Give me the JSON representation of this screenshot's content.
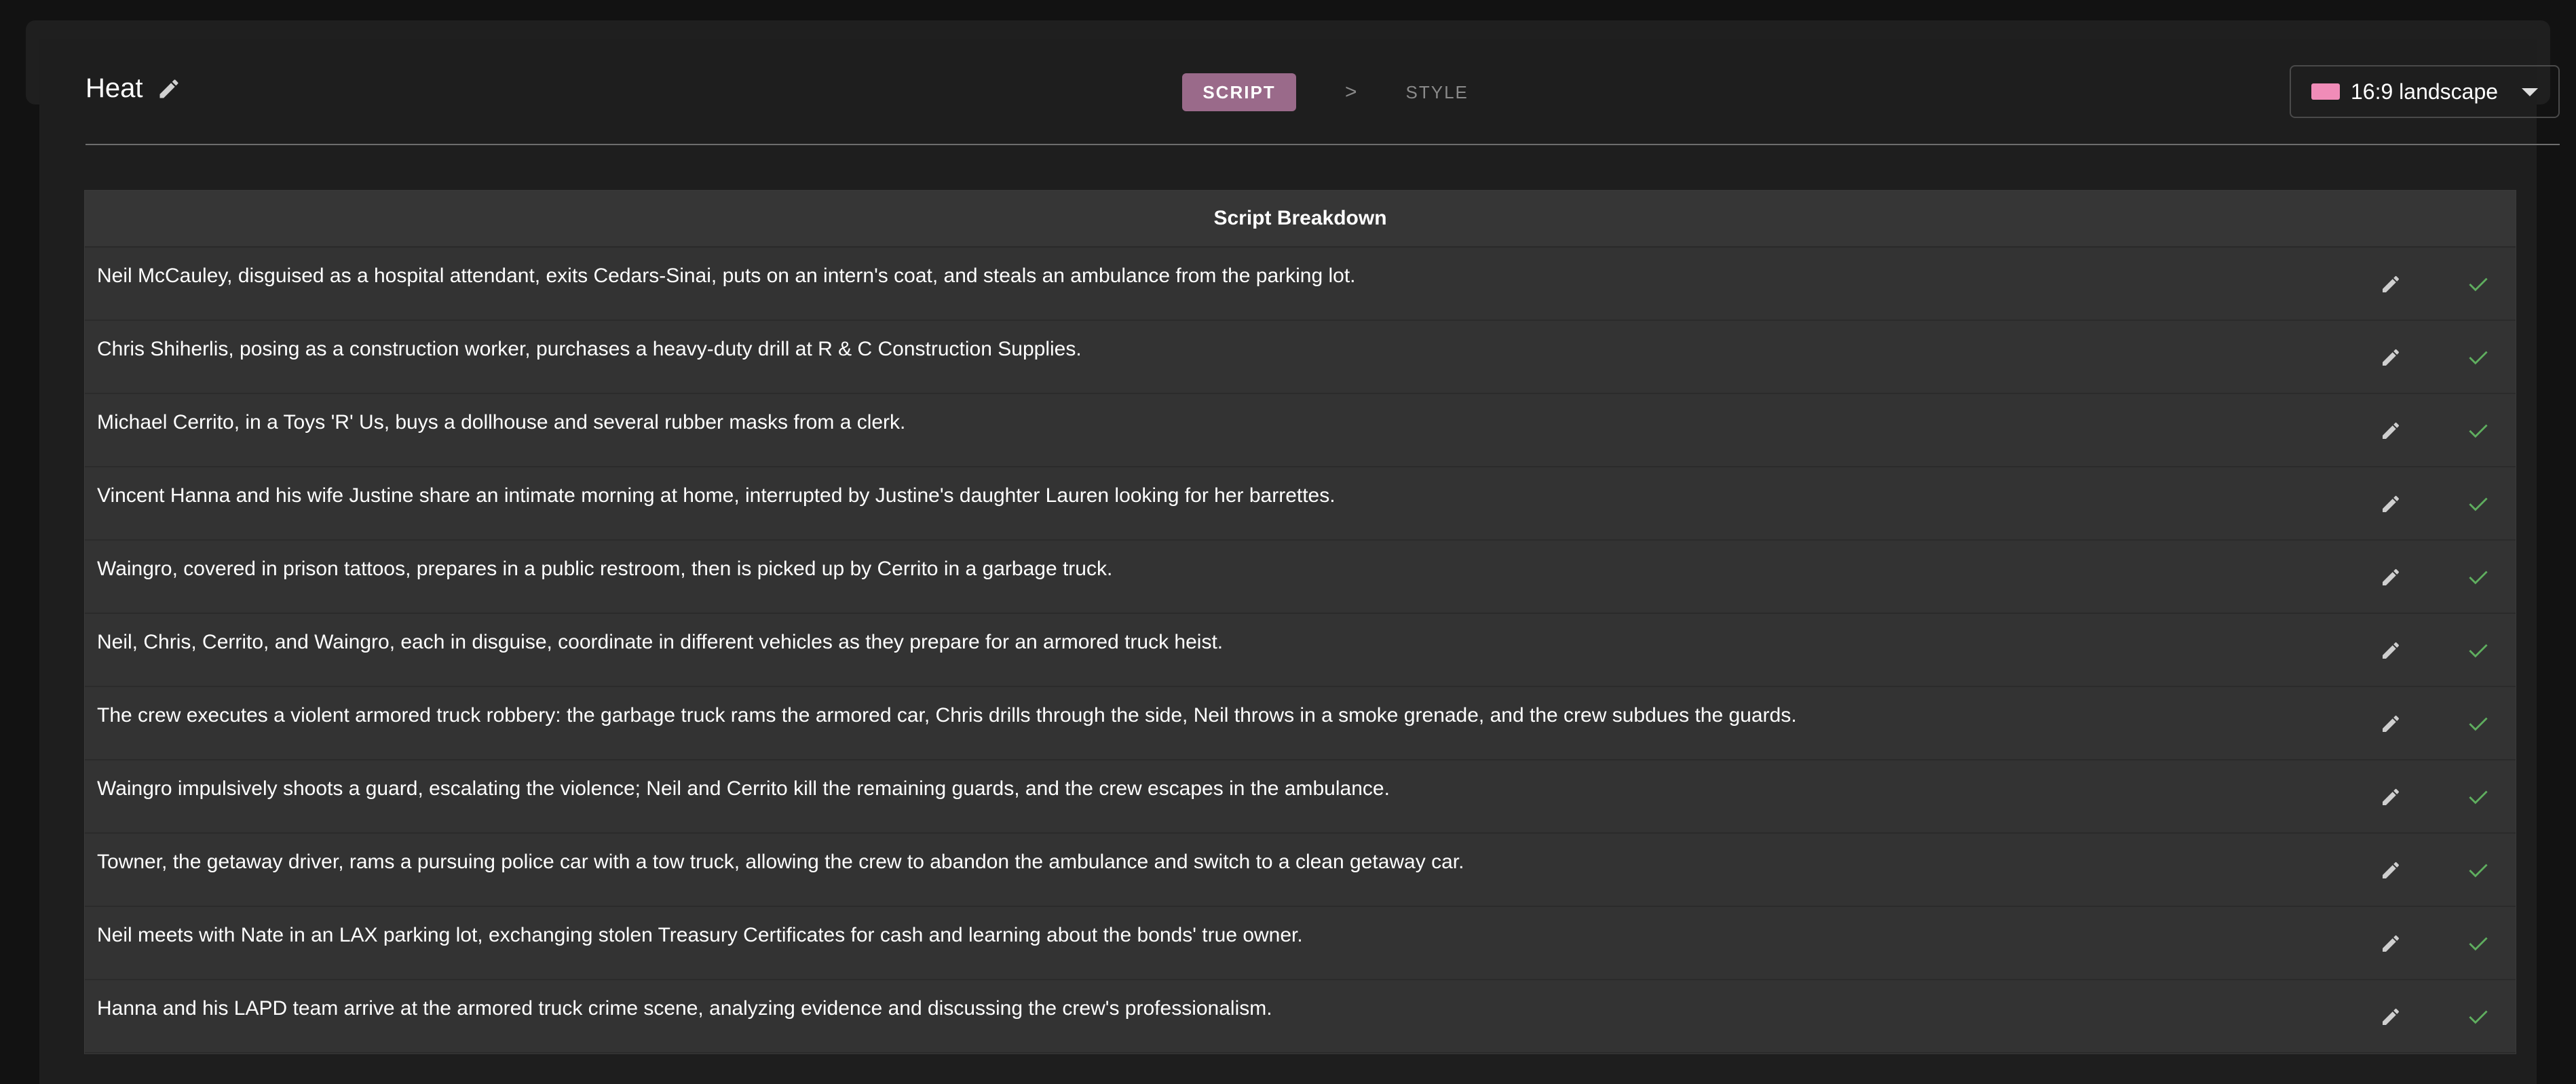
{
  "header": {
    "title": "Heat",
    "edit_title_icon": "pencil-icon"
  },
  "steps": {
    "active": "SCRIPT",
    "separator": ">",
    "next": "STYLE"
  },
  "aspect": {
    "label": "16:9 landscape",
    "swatch_color": "#f08cb8",
    "dropdown_icon": "chevron-down-icon"
  },
  "table": {
    "title": "Script Breakdown",
    "rows": [
      "Neil McCauley, disguised as a hospital attendant, exits Cedars-Sinai, puts on an intern's coat, and steals an ambulance from the parking lot.",
      "Chris Shiherlis, posing as a construction worker, purchases a heavy-duty drill at R & C Construction Supplies.",
      "Michael Cerrito, in a Toys 'R' Us, buys a dollhouse and several rubber masks from a clerk.",
      "Vincent Hanna and his wife Justine share an intimate morning at home, interrupted by Justine's daughter Lauren looking for her barrettes.",
      "Waingro, covered in prison tattoos, prepares in a public restroom, then is picked up by Cerrito in a garbage truck.",
      "Neil, Chris, Cerrito, and Waingro, each in disguise, coordinate in different vehicles as they prepare for an armored truck heist.",
      "The crew executes a violent armored truck robbery: the garbage truck rams the armored car, Chris drills through the side, Neil throws in a smoke grenade, and the crew subdues the guards.",
      "Waingro impulsively shoots a guard, escalating the violence; Neil and Cerrito kill the remaining guards, and the crew escapes in the ambulance.",
      "Towner, the getaway driver, rams a pursuing police car with a tow truck, allowing the crew to abandon the ambulance and switch to a clean getaway car.",
      "Neil meets with Nate in an LAX parking lot, exchanging stolen Treasury Certificates for cash and learning about the bonds' true owner.",
      "Hanna and his LAPD team arrive at the armored truck crime scene, analyzing evidence and discussing the crew's professionalism."
    ],
    "row_edit_icon": "pencil-icon",
    "row_confirm_icon": "check-icon",
    "confirm_color": "#5fae5f"
  }
}
